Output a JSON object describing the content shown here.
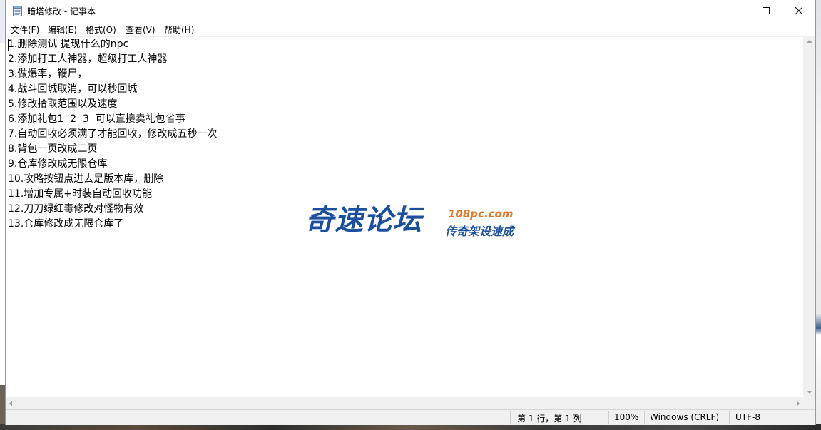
{
  "window": {
    "title": "暗塔修改 - 记事本"
  },
  "menu": {
    "items": [
      {
        "label": "文件(F)"
      },
      {
        "label": "编辑(E)"
      },
      {
        "label": "格式(O)"
      },
      {
        "label": "查看(V)"
      },
      {
        "label": "帮助(H)"
      }
    ]
  },
  "editor": {
    "lines": [
      "1.删除测试 提现什么的npc",
      "2.添加打工人神器，超级打工人神器",
      "3.做爆率，鞭尸，",
      "4.战斗回城取消，可以秒回城",
      "5.修改拾取范围以及速度",
      "6.添加礼包1  2  3  可以直接卖礼包省事",
      "7.自动回收必须满了才能回收，修改成五秒一次",
      "8.背包一页改成二页",
      "9.仓库修改成无限仓库",
      "10.攻略按钮点进去是版本库，删除",
      "11.增加专属+时装自动回收功能",
      "12.刀刀绿红毒修改对怪物有效",
      "13.仓库修改成无限仓库了"
    ]
  },
  "watermark": {
    "main": "奇速论坛",
    "url": "108pc.com",
    "sub": "传奇架设速成",
    "color_main": "#1a4f9c",
    "color_url": "#e0782a"
  },
  "status": {
    "position": "第 1 行，第 1 列",
    "zoom": "100%",
    "line_ending": "Windows (CRLF)",
    "encoding": "UTF-8"
  },
  "icons": {
    "app": "notepad-icon",
    "minimize": "minimize-icon",
    "maximize": "maximize-icon",
    "close": "close-icon"
  }
}
